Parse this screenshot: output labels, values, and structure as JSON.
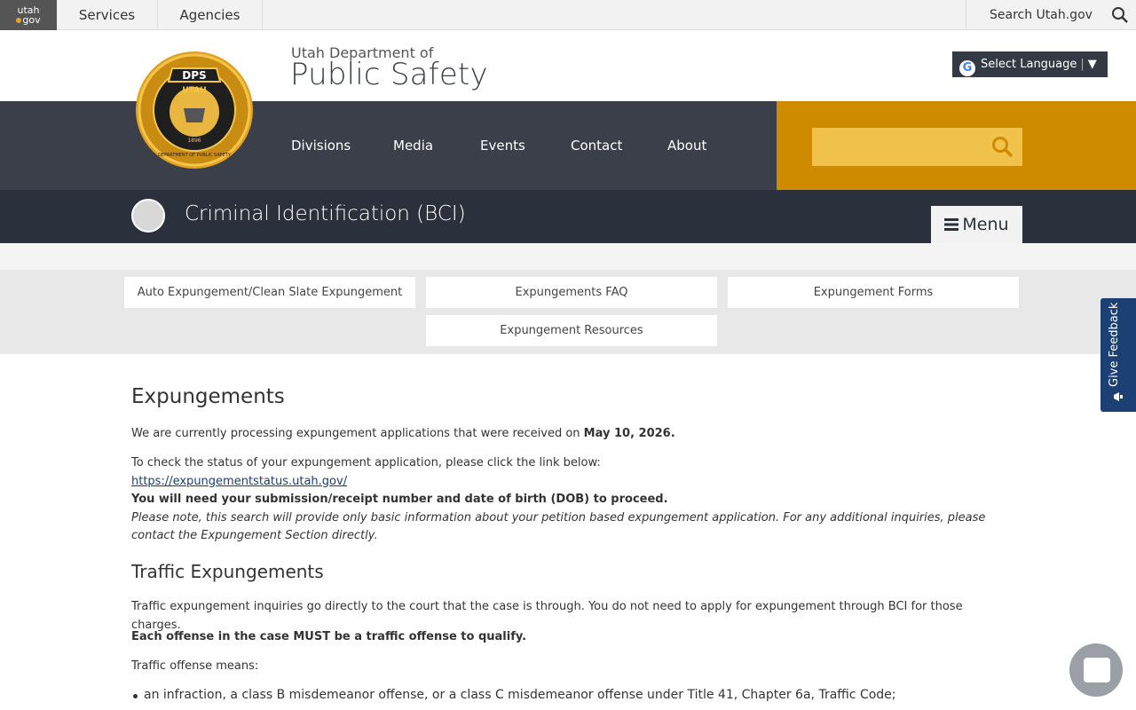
{
  "utah_bar": {
    "logo_top": "utah",
    "logo_bottom": "gov",
    "services": "Services",
    "agencies": "Agencies",
    "search_label": "Search Utah.gov"
  },
  "header": {
    "dept_sub": "Utah Department of",
    "dept_main": "Public Safety",
    "language": "Select Language",
    "language_arrow": "▼"
  },
  "seal": {
    "top": "DPS",
    "state": "UTAH",
    "ring": "DEPARTMENT OF PUBLIC SAFETY",
    "year": "1896"
  },
  "nav": {
    "items": [
      "Divisions",
      "Media",
      "Events",
      "Contact",
      "About"
    ]
  },
  "search": {
    "placeholder": ""
  },
  "division": {
    "title": "Criminal Identification (BCI)",
    "menu": "Menu"
  },
  "subnav": {
    "items": [
      "Auto Expungement/Clean Slate Expungement",
      "Expungements FAQ",
      "Expungement Forms",
      "Expungement Resources"
    ]
  },
  "content": {
    "title": "Expungements",
    "p1_pre": "We are currently processing expungement applications that were received on ",
    "p1_date": "May 10, 2026.",
    "p2": "To check the status of your expungement application, please click the link below:",
    "p2_link": "https://expungementstatus.utah.gov/",
    "p2_bold": "You will need your submission/receipt number and date of birth (DOB) to proceed.",
    "p2_italic": "Please note, this search will provide only basic information about your petition based expungement application. For any additional inquiries, please contact the Expungement Section directly.",
    "h2": "Traffic Expungements",
    "p3": "Traffic expungement inquiries go directly to the court that the case is through. You do not need to apply for expungement through BCI for those charges.",
    "p4": "Each offense in the case MUST be a traffic offense to qualify.",
    "p5": "Traffic offense means:",
    "li1": "an infraction, a class B misdemeanor offense, or a class C misdemeanor offense under Title 41, Chapter 6a, Traffic Code;"
  },
  "feedback": {
    "label": "Give Feedback"
  },
  "colors": {
    "nav_bg": "#3a3f4a",
    "division_bg": "#2b313c",
    "accent": "#cf8b00",
    "search_fill": "#f0c14b",
    "feedback_bg": "#1c3f74"
  }
}
